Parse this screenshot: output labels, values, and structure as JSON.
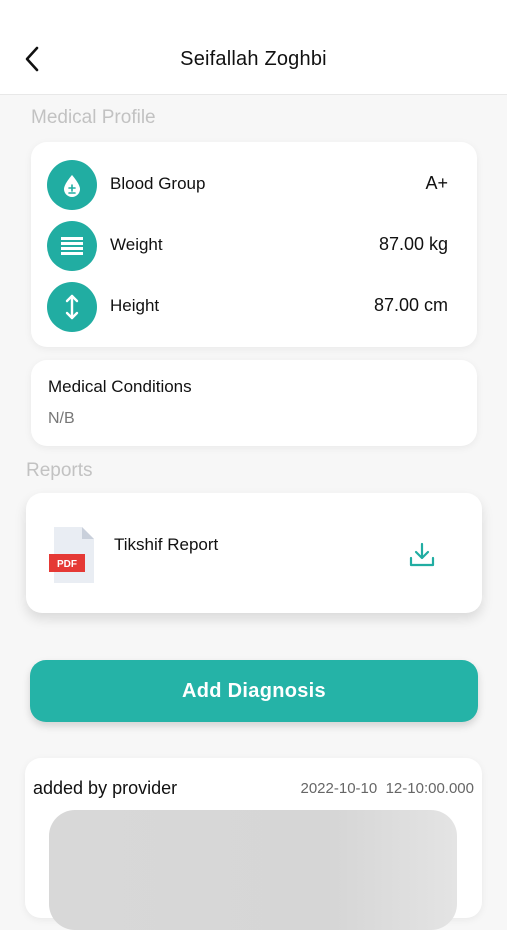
{
  "header": {
    "title": "Seifallah Zoghbi",
    "back_icon": "chevron-left-icon"
  },
  "medical_profile": {
    "section_title": "Medical Profile",
    "rows": [
      {
        "icon": "blood-drop-icon",
        "label": "Blood Group",
        "value": "A+"
      },
      {
        "icon": "weight-lines-icon",
        "label": "Weight",
        "value": "87.00 kg"
      },
      {
        "icon": "height-arrows-icon",
        "label": "Height",
        "value": "87.00 cm"
      }
    ]
  },
  "medical_conditions": {
    "title": "Medical Conditions",
    "value": "N/B"
  },
  "reports": {
    "section_title": "Reports",
    "items": [
      {
        "name": "Tikshif Report",
        "file_badge": "PDF"
      }
    ]
  },
  "add_diagnosis": {
    "label": "Add Diagnosis"
  },
  "diagnosis": {
    "author": "added by provider",
    "date": "2022-10-10",
    "time": "12-10:00.000"
  },
  "colors": {
    "accent": "#21ada2",
    "button": "#25b3a7",
    "pdf_red": "#e53935",
    "section_title": "#c2c2c2"
  }
}
